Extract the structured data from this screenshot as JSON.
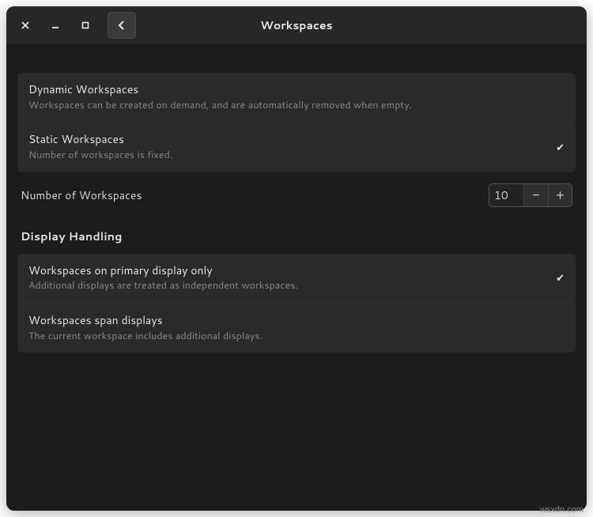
{
  "title": "Workspaces",
  "workspaces_mode": {
    "options": [
      {
        "title": "Dynamic Workspaces",
        "desc": "Workspaces can be created on demand, and are automatically removed when empty.",
        "selected": false
      },
      {
        "title": "Static Workspaces",
        "desc": "Number of workspaces is fixed.",
        "selected": true
      }
    ]
  },
  "num_workspaces": {
    "label": "Number of Workspaces",
    "value": "10",
    "minus": "−",
    "plus": "+"
  },
  "display_handling": {
    "heading": "Display Handling",
    "options": [
      {
        "title": "Workspaces on primary display only",
        "desc": "Additional displays are treated as independent workspaces.",
        "selected": true
      },
      {
        "title": "Workspaces span displays",
        "desc": "The current workspace includes additional displays.",
        "selected": false
      }
    ]
  },
  "watermark": "wsxdn.com"
}
